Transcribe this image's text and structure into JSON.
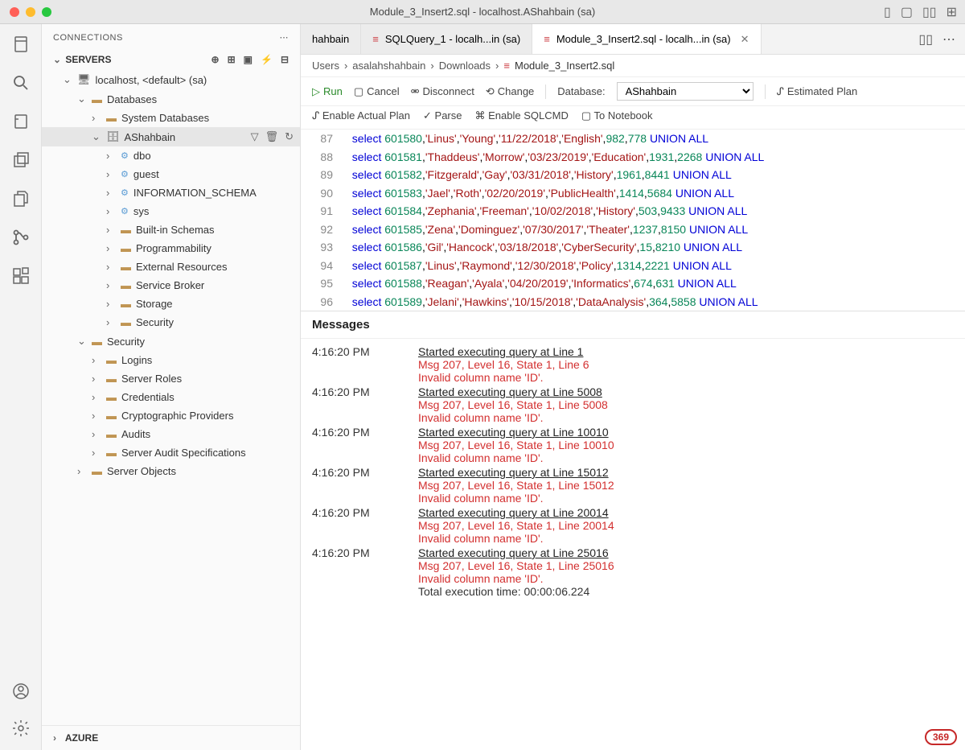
{
  "title": "Module_3_Insert2.sql - localhost.AShahbain (sa)",
  "sidebar": {
    "header": "CONNECTIONS",
    "servers_label": "SERVERS",
    "azure_label": "AZURE",
    "items": {
      "server": "localhost, <default> (sa)",
      "databases": "Databases",
      "system_db": "System Databases",
      "db_name": "AShahbain",
      "schemas": [
        "dbo",
        "guest",
        "INFORMATION_SCHEMA",
        "sys"
      ],
      "folders1": [
        "Built-in Schemas",
        "Programmability",
        "External Resources",
        "Service Broker",
        "Storage",
        "Security"
      ],
      "security": "Security",
      "security_items": [
        "Logins",
        "Server Roles",
        "Credentials",
        "Cryptographic Providers",
        "Audits",
        "Server Audit Specifications"
      ],
      "server_objects": "Server Objects"
    }
  },
  "tabs": [
    {
      "label": "hahbain",
      "active": false,
      "icon": false
    },
    {
      "label": "SQLQuery_1 - localh...in (sa)",
      "active": false,
      "icon": true
    },
    {
      "label": "Module_3_Insert2.sql - localh...in (sa)",
      "active": true,
      "icon": true
    }
  ],
  "breadcrumb": [
    "Users",
    "asalahshahbain",
    "Downloads",
    "Module_3_Insert2.sql"
  ],
  "toolbar": {
    "run": "Run",
    "cancel": "Cancel",
    "disconnect": "Disconnect",
    "change": "Change",
    "database_label": "Database:",
    "database_value": "AShahbain",
    "estimated_plan": "Estimated Plan",
    "enable_actual": "Enable Actual Plan",
    "parse": "Parse",
    "enable_sqlcmd": "Enable SQLCMD",
    "to_notebook": "To Notebook"
  },
  "code": [
    {
      "ln": 87,
      "id": "601580",
      "a": "Linus",
      "b": "Young",
      "c": "11/22/2018",
      "d": "English",
      "e": "982",
      "f": "778"
    },
    {
      "ln": 88,
      "id": "601581",
      "a": "Thaddeus",
      "b": "Morrow",
      "c": "03/23/2019",
      "d": "Education",
      "e": "1931",
      "f": "2268"
    },
    {
      "ln": 89,
      "id": "601582",
      "a": "Fitzgerald",
      "b": "Gay",
      "c": "03/31/2018",
      "d": "History",
      "e": "1961",
      "f": "8441"
    },
    {
      "ln": 90,
      "id": "601583",
      "a": "Jael",
      "b": "Roth",
      "c": "02/20/2019",
      "d": "PublicHealth",
      "e": "1414",
      "f": "5684"
    },
    {
      "ln": 91,
      "id": "601584",
      "a": "Zephania",
      "b": "Freeman",
      "c": "10/02/2018",
      "d": "History",
      "e": "503",
      "f": "9433"
    },
    {
      "ln": 92,
      "id": "601585",
      "a": "Zena",
      "b": "Dominguez",
      "c": "07/30/2017",
      "d": "Theater",
      "e": "1237",
      "f": "8150"
    },
    {
      "ln": 93,
      "id": "601586",
      "a": "Gil",
      "b": "Hancock",
      "c": "03/18/2018",
      "d": "CyberSecurity",
      "e": "15",
      "f": "8210"
    },
    {
      "ln": 94,
      "id": "601587",
      "a": "Linus",
      "b": "Raymond",
      "c": "12/30/2018",
      "d": "Policy",
      "e": "1314",
      "f": "2221"
    },
    {
      "ln": 95,
      "id": "601588",
      "a": "Reagan",
      "b": "Ayala",
      "c": "04/20/2019",
      "d": "Informatics",
      "e": "674",
      "f": "631"
    },
    {
      "ln": 96,
      "id": "601589",
      "a": "Jelani",
      "b": "Hawkins",
      "c": "10/15/2018",
      "d": "DataAnalysis",
      "e": "364",
      "f": "5858"
    }
  ],
  "messages_header": "Messages",
  "messages": [
    {
      "time": "4:16:20 PM",
      "lines": [
        {
          "text": "Started executing query at Line 1",
          "cls": "msg-link"
        },
        {
          "text": "Msg 207, Level 16, State 1, Line 6",
          "cls": "msg-err"
        },
        {
          "text": "Invalid column name 'ID'.",
          "cls": "msg-err"
        }
      ]
    },
    {
      "time": "4:16:20 PM",
      "lines": [
        {
          "text": "Started executing query at Line 5008",
          "cls": "msg-link"
        },
        {
          "text": "Msg 207, Level 16, State 1, Line 5008",
          "cls": "msg-err"
        },
        {
          "text": "Invalid column name 'ID'.",
          "cls": "msg-err"
        }
      ]
    },
    {
      "time": "4:16:20 PM",
      "lines": [
        {
          "text": "Started executing query at Line 10010",
          "cls": "msg-link"
        },
        {
          "text": "Msg 207, Level 16, State 1, Line 10010",
          "cls": "msg-err"
        },
        {
          "text": "Invalid column name 'ID'.",
          "cls": "msg-err"
        }
      ]
    },
    {
      "time": "4:16:20 PM",
      "lines": [
        {
          "text": "Started executing query at Line 15012",
          "cls": "msg-link"
        },
        {
          "text": "Msg 207, Level 16, State 1, Line 15012",
          "cls": "msg-err"
        },
        {
          "text": "Invalid column name 'ID'.",
          "cls": "msg-err"
        }
      ]
    },
    {
      "time": "4:16:20 PM",
      "lines": [
        {
          "text": "Started executing query at Line 20014",
          "cls": "msg-link"
        },
        {
          "text": "Msg 207, Level 16, State 1, Line 20014",
          "cls": "msg-err"
        },
        {
          "text": "Invalid column name 'ID'.",
          "cls": "msg-err"
        }
      ]
    },
    {
      "time": "4:16:20 PM",
      "lines": [
        {
          "text": "Started executing query at Line 25016",
          "cls": "msg-link"
        },
        {
          "text": "Msg 207, Level 16, State 1, Line 25016",
          "cls": "msg-err"
        },
        {
          "text": "Invalid column name 'ID'.",
          "cls": "msg-err"
        },
        {
          "text": "Total execution time: 00:00:06.224",
          "cls": "msg-normal"
        }
      ]
    }
  ],
  "status_badge": "369"
}
